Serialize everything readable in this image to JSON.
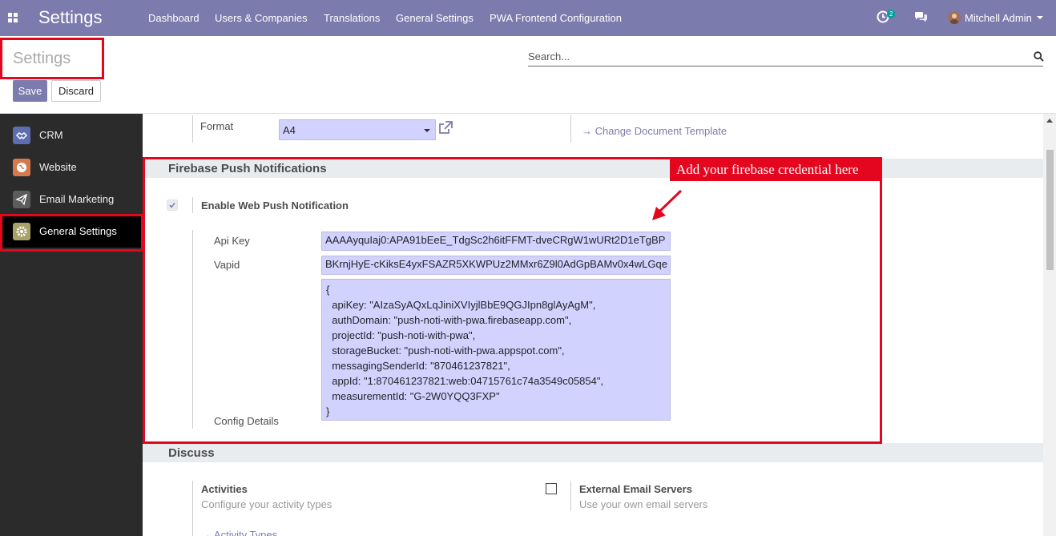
{
  "app": {
    "title": "Settings"
  },
  "nav": {
    "items": [
      "Dashboard",
      "Users & Companies",
      "Translations",
      "General Settings",
      "PWA Frontend Configuration"
    ]
  },
  "systray": {
    "activity_count": "2",
    "user": "Mitchell Admin"
  },
  "control": {
    "breadcrumb": "Settings",
    "save": "Save",
    "discard": "Discard",
    "search_placeholder": "Search..."
  },
  "sidebar": {
    "items": [
      {
        "label": "CRM",
        "color": "#5f6db0"
      },
      {
        "label": "Website",
        "color": "#d67a4c"
      },
      {
        "label": "Email Marketing",
        "color": "#5c5c5c"
      },
      {
        "label": "General Settings",
        "color": "#a9a16a"
      }
    ]
  },
  "format": {
    "label": "Format",
    "value": "A4",
    "link": "Change Document Template"
  },
  "firebase": {
    "heading": "Firebase Push Notifications",
    "annotation": "Add your firebase credential here",
    "enable_label": "Enable Web Push Notification",
    "api_key_label": "Api Key",
    "api_key_value": "AAAAyquIaj0:APA91bEeE_TdgSc2h6itFFMT-dveCRgW1wURt2D1eTgBP",
    "vapid_label": "Vapid",
    "vapid_value": "BKrnjHyE-cKiksE4yxFSAZR5XKWPUz2MMxr6Z9l0AdGpBAMv0x4wLGqe",
    "config_label": "Config Details",
    "config_value": "{\n  apiKey: \"AIzaSyAQxLqJiniXVIyjlBbE9QGJIpn8glAyAgM\",\n  authDomain: \"push-noti-with-pwa.firebaseapp.com\",\n  projectId: \"push-noti-with-pwa\",\n  storageBucket: \"push-noti-with-pwa.appspot.com\",\n  messagingSenderId: \"870461237821\",\n  appId: \"1:870461237821:web:04715761c74a3549c05854\",\n  measurementId: \"G-2W0YQQ3FXP\"\n}"
  },
  "discuss": {
    "heading": "Discuss",
    "activities_title": "Activities",
    "activities_desc": "Configure your activity types",
    "activity_types_link": "Activity Types",
    "email_title": "External Email Servers",
    "email_desc": "Use your own email servers"
  },
  "colors": {
    "brand": "#7c7bad",
    "highlight": "#e4051f",
    "input_bg": "#d2d2ff"
  }
}
